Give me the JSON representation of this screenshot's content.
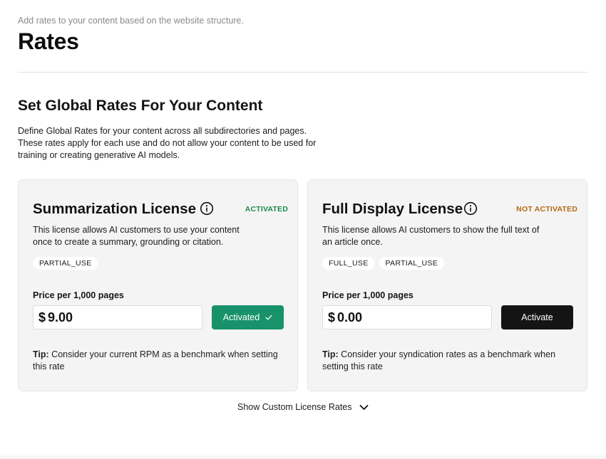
{
  "header": {
    "subtitle": "Add rates to your content based on the website structure.",
    "title": "Rates"
  },
  "section": {
    "title": "Set Global Rates For Your Content",
    "description": "Define Global Rates for your content across all subdirectories and pages. These rates apply for each use and do not allow your content to be used for training or creating generative AI models."
  },
  "cards": [
    {
      "title": "Summarization License",
      "status": "ACTIVATED",
      "description": "This license allows AI customers to use your content once to create a summary, grounding or citation.",
      "tags": [
        "PARTIAL_USE"
      ],
      "price_label": "Price per 1,000 pages",
      "currency": "$",
      "price": "9.00",
      "button_label": "Activated",
      "tip_prefix": "Tip:",
      "tip": "Consider your current RPM as a benchmark when setting this rate"
    },
    {
      "title": "Full Display License",
      "status": "NOT ACTIVATED",
      "description": "This license allows AI customers to show the full text of an article once.",
      "tags": [
        "FULL_USE",
        "PARTIAL_USE"
      ],
      "price_label": "Price per 1,000 pages",
      "currency": "$",
      "price": "0.00",
      "button_label": "Activate",
      "tip_prefix": "Tip:",
      "tip": "Consider your syndication rates as a benchmark when setting this rate"
    }
  ],
  "footer": {
    "show_custom_label": "Show Custom License Rates"
  },
  "colors": {
    "activated_status": "#1f8a4c",
    "not_activated_status": "#b36a12",
    "activated_button": "#17926a",
    "activate_button": "#141414"
  },
  "icons": {
    "info": "info-icon",
    "check": "check-icon",
    "chevron": "chevron-down-icon"
  }
}
